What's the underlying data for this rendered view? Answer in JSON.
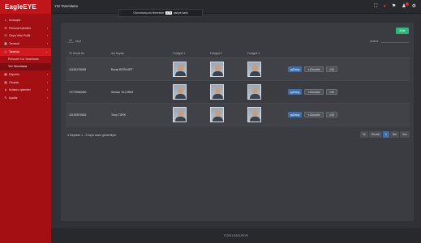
{
  "brand": "EagleEYE",
  "sidebar": {
    "items": [
      {
        "icon": "home-icon",
        "glyph": "⌂",
        "label": "Anasayfa",
        "chevron": ""
      },
      {
        "icon": "users-icon",
        "glyph": "☷",
        "label": "Personel İşlemleri",
        "chevron": "›"
      },
      {
        "icon": "key-icon",
        "glyph": "⚿",
        "label": "Geçiş Yetki Profili",
        "chevron": "›"
      },
      {
        "icon": "terminal-icon",
        "glyph": "▣",
        "label": "Terminal",
        "chevron": "›"
      },
      {
        "icon": "face-icon",
        "glyph": "☺",
        "label": "Tanımlar",
        "chevron": "⌄",
        "active": true
      }
    ],
    "subitems": [
      {
        "label": "Personel Yüz Tanımlama"
      },
      {
        "label": "Yüz Tanımlama",
        "current": true
      }
    ],
    "items2": [
      {
        "icon": "report-icon",
        "glyph": "▤",
        "label": "Raporlar",
        "chevron": "›"
      },
      {
        "icon": "device-icon",
        "glyph": "▥",
        "label": "Cihazlar",
        "chevron": "›"
      },
      {
        "icon": "user-ops-icon",
        "glyph": "♙",
        "label": "Kullanıcı İşlemleri",
        "chevron": "›"
      },
      {
        "icon": "wrench-icon",
        "glyph": "✎",
        "label": "Ayarlar",
        "chevron": "›"
      }
    ]
  },
  "topbar": {
    "title": "Yüz Tanımlama",
    "session_pre": "Oturumunuzun bitmesine",
    "session_count": "179",
    "session_post": "saniye kaldı"
  },
  "panel": {
    "add_label": "Ekle",
    "show_label": "10",
    "show_suffix": "kayıt",
    "search_label": "Arama:",
    "search_placeholder": ""
  },
  "table": {
    "columns": [
      "TC Kimlik No",
      "Adı Soyadı",
      "Fotoğraf 1",
      "Fotoğraf 2",
      "Fotoğraf 3",
      ""
    ],
    "rows": [
      {
        "tc": "41181176698",
        "name": "Burak BOZKURT"
      },
      {
        "tc": "72778960050",
        "name": "Serkan YILDIRIM"
      },
      {
        "tc": "10192579452",
        "name": "Tunç TÜRK"
      }
    ],
    "action_detail": "Detay",
    "action_update": "Güncelle",
    "action_delete": "Sil"
  },
  "info": "3 Kayıttan 1 - 3 kayıt arası gösteriliyor",
  "pager": {
    "first": "İlk",
    "prev": "Önceki",
    "page": "1",
    "next": "İleri",
    "last": "Son"
  },
  "footer": "© 2021 EAGLEEYE",
  "colors": {
    "sidebar": "#a40f14",
    "accent_green": "#2fb67a",
    "accent_blue": "#3f6ea8"
  }
}
